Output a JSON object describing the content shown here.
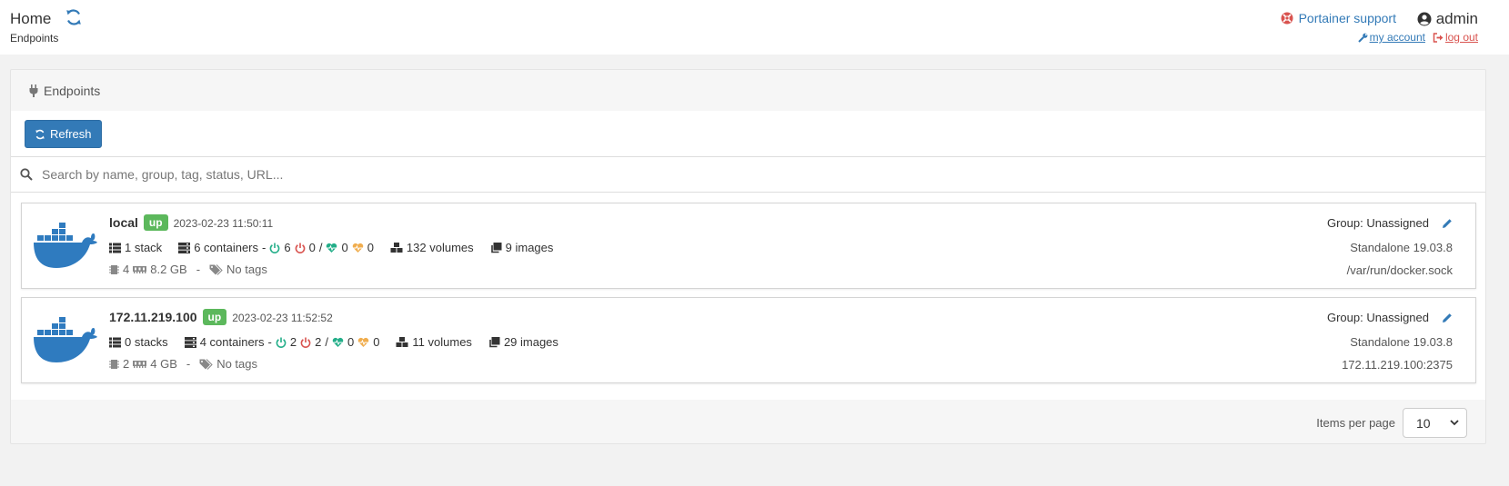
{
  "header": {
    "title": "Home",
    "breadcrumb": "Endpoints",
    "support_label": "Portainer support",
    "username": "admin",
    "my_account_label": "my account",
    "log_out_label": "log out"
  },
  "widget": {
    "title": "Endpoints",
    "refresh_label": "Refresh",
    "search_placeholder": "Search by name, group, tag, status, URL...",
    "items_per_page_label": "Items per page",
    "items_per_page_value": "10"
  },
  "endpoints": [
    {
      "name": "local",
      "status": "up",
      "timestamp": "2023-02-23 11:50:11",
      "stacks": "1 stack",
      "containers": "6 containers",
      "running": "6",
      "stopped": "0",
      "healthy": "0",
      "unhealthy": "0",
      "volumes": "132 volumes",
      "images": "9 images",
      "cpu": "4",
      "memory": "8.2 GB",
      "tags": "No tags",
      "group": "Group: Unassigned",
      "type": "Standalone 19.03.8",
      "url": "/var/run/docker.sock"
    },
    {
      "name": "172.11.219.100",
      "status": "up",
      "timestamp": "2023-02-23 11:52:52",
      "stacks": "0 stacks",
      "containers": "4 containers",
      "running": "2",
      "stopped": "2",
      "healthy": "0",
      "unhealthy": "0",
      "volumes": "11 volumes",
      "images": "29 images",
      "cpu": "2",
      "memory": "4 GB",
      "tags": "No tags",
      "group": "Group: Unassigned",
      "type": "Standalone 19.03.8",
      "url": "172.11.219.100:2375"
    }
  ],
  "colors": {
    "primary": "#337ab7",
    "success": "#5cb85c",
    "danger": "#d9534f",
    "running": "#23ae89",
    "stopped": "#d9534f",
    "healthy": "#23ae89",
    "unhealthy": "#f0ad4e",
    "docker": "#2f7bbf"
  }
}
